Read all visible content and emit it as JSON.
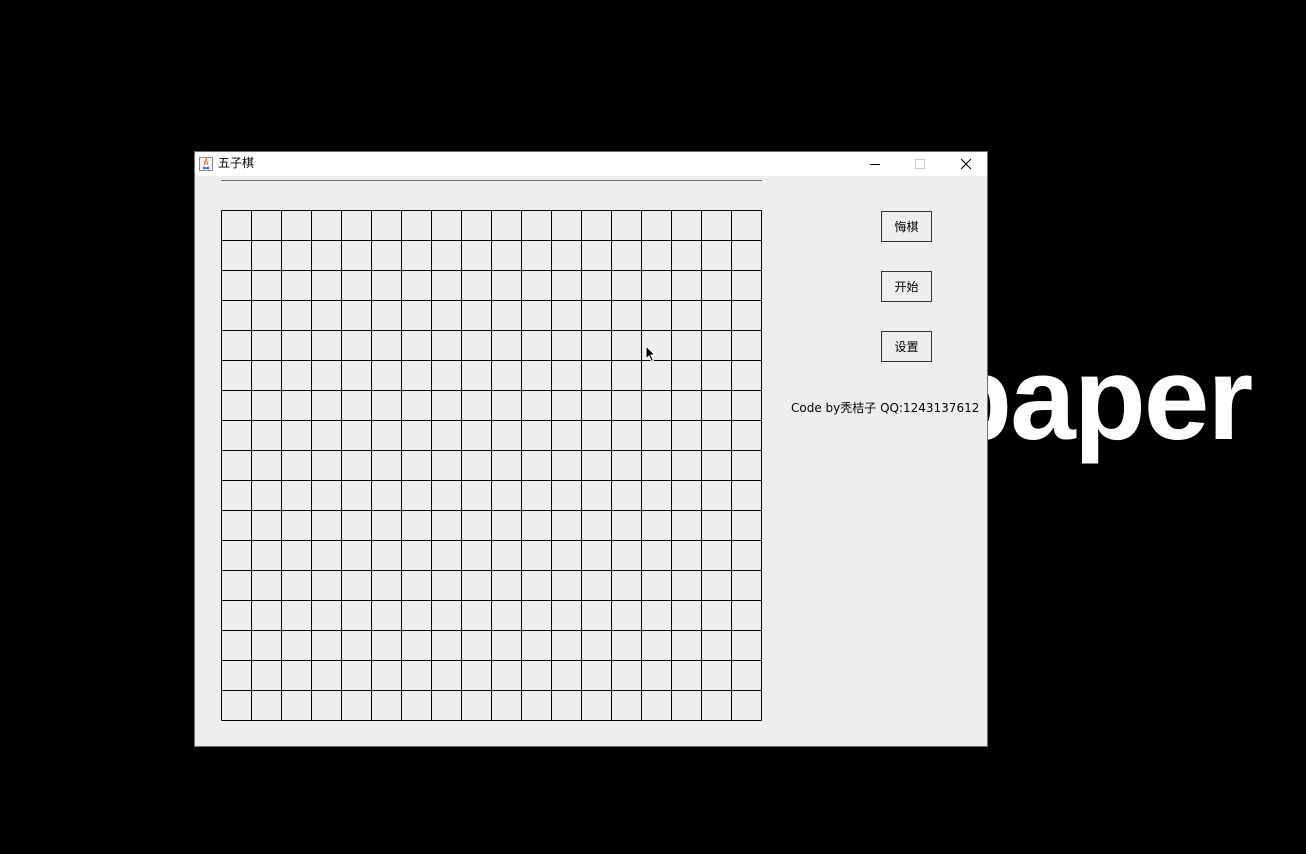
{
  "desktop": {
    "wallpaper_text": "paper"
  },
  "window": {
    "title": "五子棋",
    "controls": {
      "minimize_icon": "minimize-icon",
      "maximize_icon": "maximize-icon",
      "close_icon": "close-icon"
    }
  },
  "board": {
    "columns": 18,
    "rows": 17,
    "line_color": "#000000",
    "background": "#eeeeee"
  },
  "sidebar": {
    "undo_label": "悔棋",
    "start_label": "开始",
    "settings_label": "设置",
    "credit": "Code by秃桔子 QQ:1243137612"
  },
  "colors": {
    "desktop": "#000000",
    "window_body": "#eeeeee",
    "titlebar": "#ffffff"
  }
}
